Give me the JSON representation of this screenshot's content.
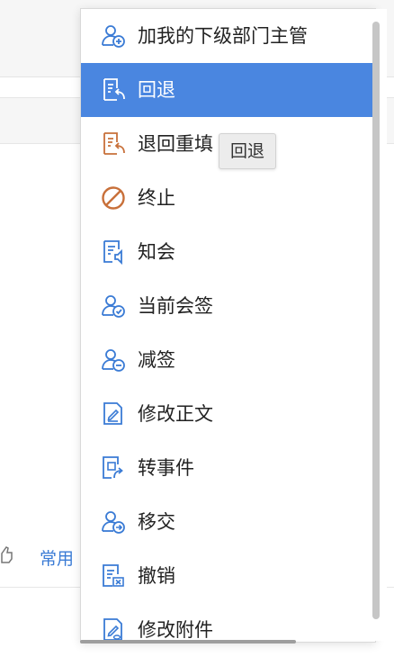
{
  "background": {
    "footer_link": "常用"
  },
  "menu": {
    "items": [
      {
        "label": "加我的下级部门主管",
        "icon": "add-user-icon",
        "active": false
      },
      {
        "label": "回退",
        "icon": "document-return-icon",
        "active": true
      },
      {
        "label": "退回重填",
        "icon": "document-return-orange-icon",
        "active": false
      },
      {
        "label": "终止",
        "icon": "prohibit-icon",
        "active": false
      },
      {
        "label": "知会",
        "icon": "document-notify-icon",
        "active": false
      },
      {
        "label": "当前会签",
        "icon": "user-check-icon",
        "active": false
      },
      {
        "label": "减签",
        "icon": "user-minus-icon",
        "active": false
      },
      {
        "label": "修改正文",
        "icon": "document-edit-icon",
        "active": false
      },
      {
        "label": "转事件",
        "icon": "transfer-event-icon",
        "active": false
      },
      {
        "label": "移交",
        "icon": "user-transfer-icon",
        "active": false
      },
      {
        "label": "撤销",
        "icon": "document-cancel-icon",
        "active": false
      },
      {
        "label": "修改附件",
        "icon": "attachment-edit-icon",
        "active": false
      }
    ]
  },
  "tooltip": {
    "text": "回退"
  },
  "colors": {
    "accent": "#4a86e0",
    "icon_blue": "#3a7bd5",
    "icon_orange": "#c8703a"
  }
}
